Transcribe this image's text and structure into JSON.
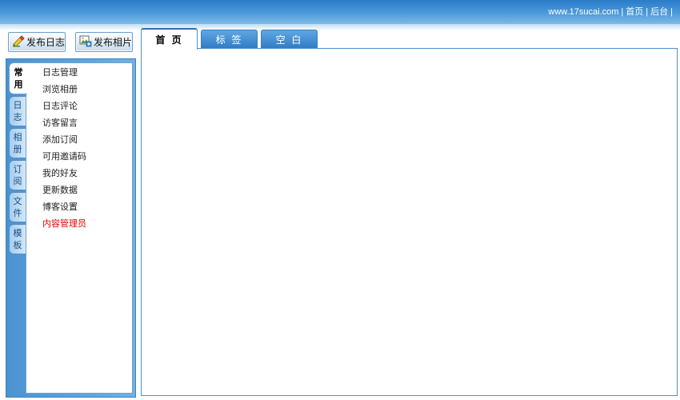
{
  "header": {
    "links": [
      "www.17sucai.com",
      "首页",
      "后台"
    ],
    "separator": "|"
  },
  "actions": {
    "post_blog": "发布日志",
    "post_photo": "发布相片"
  },
  "side_tabs": [
    {
      "chars": [
        "常",
        "用"
      ],
      "active": true
    },
    {
      "chars": [
        "日",
        "志"
      ],
      "active": false
    },
    {
      "chars": [
        "相",
        "册"
      ],
      "active": false
    },
    {
      "chars": [
        "订",
        "阅"
      ],
      "active": false
    },
    {
      "chars": [
        "文",
        "件"
      ],
      "active": false
    },
    {
      "chars": [
        "模",
        "板"
      ],
      "active": false
    }
  ],
  "menu": [
    "日志管理",
    "浏览相册",
    "日志评论",
    "访客留言",
    "添加订阅",
    "可用邀请码",
    "我的好友",
    "更新数据",
    "博客设置",
    "内容管理员"
  ],
  "main_tabs": [
    "首 页",
    "标 签",
    "空 白"
  ],
  "colors": {
    "highlight_menu_item": "#e00000",
    "accent_blue": "#2f7bc4"
  },
  "icons": {
    "post_blog": "pencil-icon",
    "post_photo": "photo-icon"
  }
}
